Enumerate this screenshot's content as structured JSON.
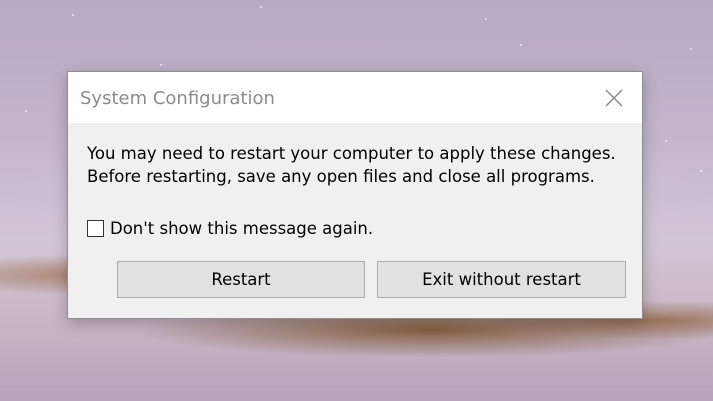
{
  "dialog": {
    "title": "System Configuration",
    "message_line1": "You may need to restart your computer to apply these changes.",
    "message_line2": "Before restarting, save any open files and close all programs.",
    "checkbox_label": "Don't show this message again.",
    "checkbox_checked": false,
    "restart_label": "Restart",
    "exit_label": "Exit without restart",
    "close_icon": "close-icon"
  }
}
